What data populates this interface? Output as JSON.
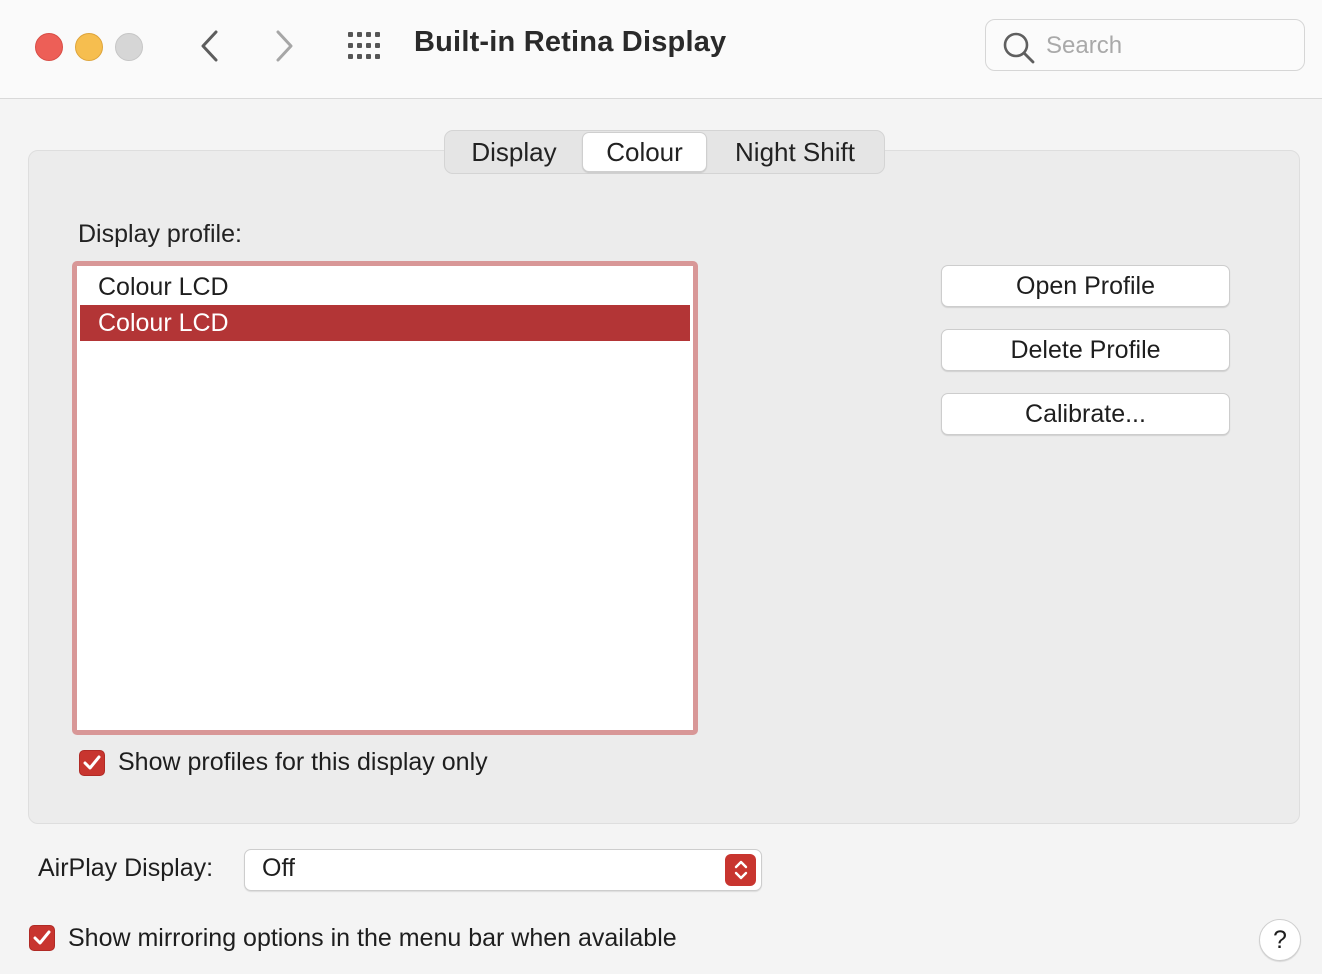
{
  "window": {
    "title": "Built-in Retina Display"
  },
  "toolbar": {
    "back_icon": "chevron-left-icon",
    "forward_icon": "chevron-right-icon",
    "grid_icon": "show-all-grid-icon",
    "search": {
      "placeholder": "Search",
      "value": ""
    }
  },
  "tabs": [
    {
      "label": "Display",
      "selected": false
    },
    {
      "label": "Colour",
      "selected": true
    },
    {
      "label": "Night Shift",
      "selected": false
    }
  ],
  "colour": {
    "profile_label": "Display profile:",
    "profiles": [
      {
        "label": "Colour LCD",
        "selected": false
      },
      {
        "label": "Colour LCD",
        "selected": true
      }
    ],
    "buttons": {
      "open": "Open Profile",
      "delete": "Delete Profile",
      "calibrate": "Calibrate..."
    },
    "show_profiles_checkbox": {
      "label": "Show profiles for this display only",
      "checked": true
    }
  },
  "footer": {
    "airplay_label": "AirPlay Display:",
    "airplay_value": "Off",
    "mirror_checkbox": {
      "label": "Show mirroring options in the menu bar when available",
      "checked": true
    },
    "help_label": "?"
  },
  "colors": {
    "accent": "#c8352f",
    "selection": "#b33536",
    "focus_ring": "#d89797",
    "close": "#ed5f57",
    "minimize": "#f6be4f",
    "zoom_disabled": "#d6d6d6"
  }
}
